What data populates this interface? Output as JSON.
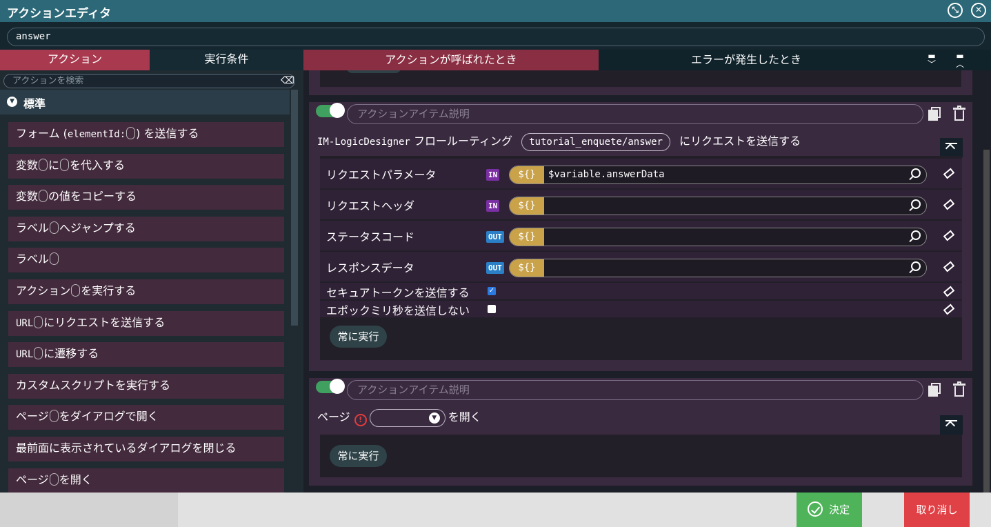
{
  "window": {
    "title": "アクションエディタ"
  },
  "header": {
    "name_value": "answer"
  },
  "left": {
    "tabs": [
      "アクション",
      "実行条件"
    ],
    "search_placeholder": "アクションを検索",
    "category": "標準",
    "items": [
      {
        "parts": [
          "フォーム (",
          "elementId:",
          "",
          ") を送信する"
        ]
      },
      {
        "parts": [
          "変数",
          "",
          "に",
          "",
          "を代入する"
        ]
      },
      {
        "parts": [
          "変数",
          "",
          "の値をコピーする"
        ]
      },
      {
        "parts": [
          "ラベル",
          "",
          "へジャンプする"
        ]
      },
      {
        "parts": [
          "ラベル",
          ""
        ]
      },
      {
        "parts": [
          "アクション",
          "",
          "を実行する"
        ]
      },
      {
        "parts": [
          "URL",
          "",
          "にリクエストを送信する"
        ]
      },
      {
        "parts": [
          "URL",
          "",
          "に遷移する"
        ]
      },
      {
        "parts": [
          "カスタムスクリプトを実行する"
        ]
      },
      {
        "parts": [
          "ページ",
          "",
          "をダイアログで開く"
        ]
      },
      {
        "parts": [
          "最前面に表示されているダイアログを閉じる"
        ]
      },
      {
        "parts": [
          "ページ",
          "",
          "を開く"
        ]
      }
    ]
  },
  "right": {
    "tabs": [
      "アクションが呼ばれたとき",
      "エラーが発生したとき"
    ],
    "card1": {
      "desc_placeholder": "アクションアイテム説明",
      "prefix": "IM-LogicDesigner",
      "mid": "フロールーティング",
      "chip": "tutorial_enquete/answer",
      "suffix": "にリクエストを送信する",
      "params": [
        {
          "label": "リクエストパラメータ",
          "dir": "IN",
          "value": "$variable.answerData"
        },
        {
          "label": "リクエストヘッダ",
          "dir": "IN",
          "value": ""
        },
        {
          "label": "ステータスコード",
          "dir": "OUT",
          "value": ""
        },
        {
          "label": "レスポンスデータ",
          "dir": "OUT",
          "value": ""
        }
      ],
      "checks": [
        {
          "label": "セキュアトークンを送信する",
          "checked": true
        },
        {
          "label": "エポックミリ秒を送信しない",
          "checked": false
        }
      ],
      "always": "常に実行",
      "dollar": "${}"
    },
    "card2": {
      "desc_placeholder": "アクションアイテム説明",
      "page_label": "ページ",
      "suffix": "を開く",
      "always": "常に実行"
    }
  },
  "footer": {
    "ok": "決定",
    "cancel": "取り消し"
  },
  "colors": {
    "accent": "#a8394e",
    "title_bar": "#2c6877",
    "ok": "#4fb35a",
    "cancel": "#e04146"
  }
}
